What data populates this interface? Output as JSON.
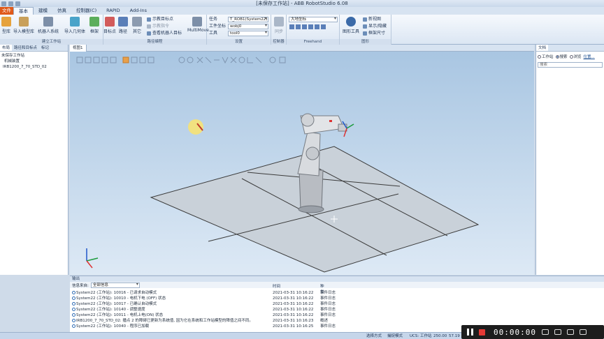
{
  "app": {
    "title": "[未保存工作站] - ABB RobotStudio 6.08"
  },
  "tabs": [
    {
      "label": "文件"
    },
    {
      "label": "基本"
    },
    {
      "label": "建模"
    },
    {
      "label": "仿真"
    },
    {
      "label": "控制器(C)"
    },
    {
      "label": "RAPID"
    },
    {
      "label": "Add-Ins"
    }
  ],
  "ribbon": {
    "build": {
      "label": "建立工作站",
      "abb_library": "型库",
      "import_library": "导入模型库",
      "robot_system": "机器人系统",
      "import_geometry": "导入几何体",
      "frame": "框架"
    },
    "path": {
      "label": "路径编程",
      "target": "目标点",
      "path": "路径",
      "other": "其它",
      "teach_target": "示教目标点",
      "teach_instruction": "示教指令",
      "view_robot_target": "查看机器人目标",
      "multimove": "MultiMove"
    },
    "settings": {
      "label": "设置",
      "task_label": "任务",
      "task_value": "T_ROB1(System22)",
      "wobj_label": "工件坐标",
      "wobj_value": "wobj0",
      "tool_label": "工具",
      "tool_value": "tool0"
    },
    "controller": {
      "label": "控制器",
      "sync": "同步"
    },
    "freehand": {
      "label": "Freehand",
      "frame_value": "大地坐标"
    },
    "graphics": {
      "label": "图形",
      "graphics_tools": "图形工具",
      "new_view": "新视图",
      "show_hide": "显示/隐藏",
      "frame_size": "框架尺寸"
    }
  },
  "left_panel": {
    "tabs": [
      "布局",
      "路径和目标点",
      "标记"
    ],
    "tree": [
      "未保存工作站",
      "机械装置",
      "IRB1200_7_70_STD_02"
    ]
  },
  "viewport": {
    "tab": "视图1"
  },
  "right_panel": {
    "title": "文档",
    "radio_workstation": "工作站",
    "radio_search": "搜索",
    "radio_browse": "浏览",
    "link_location": "位置...",
    "search_placeholder": "搜索"
  },
  "output": {
    "title": "输出",
    "filter_label": "信息来自:",
    "filter_value": "全部信息",
    "col_time": "时间",
    "col_category": "种类",
    "rows": [
      {
        "msg": "System22 (工作站): 10016 - 已请求自动模式",
        "time": "2021-03-31 10:16:22",
        "cat": "事件日志"
      },
      {
        "msg": "System22 (工作站): 10010 - 电机下电 (OFF) 状态",
        "time": "2021-03-31 10:16:22",
        "cat": "事件日志"
      },
      {
        "msg": "System22 (工作站): 10017 - 已确认自动模式",
        "time": "2021-03-31 10:16:22",
        "cat": "事件日志"
      },
      {
        "msg": "System22 (工作站): 10140 - 调整速度",
        "time": "2021-03-31 10:16:22",
        "cat": "事件日志"
      },
      {
        "msg": "System22 (工作站): 10011 - 电机上电(ON) 状态",
        "time": "2021-03-31 10:16:22",
        "cat": "事件日志"
      },
      {
        "msg": "IRB1200_7_70_STD_02: 播点 2 的障碍已更新为系统值, 因为它在系统和工作站模型的障值之间不同。",
        "time": "2021-03-31 10:16:23",
        "cat": "概述"
      },
      {
        "msg": "System22 (工作站): 10040 - 程序已加载",
        "time": "2021-03-31 10:16:25",
        "cat": "事件日志"
      }
    ]
  },
  "status_bar": {
    "select_mode": "选择方式",
    "snap_mode": "捕捉模式",
    "ucs": "UCS: 工作站",
    "x": "250.00",
    "y": "57.19"
  },
  "recorder": {
    "time": "00:00:00"
  },
  "colors": {
    "file_tab": "#e05a1a",
    "accent": "#1b4d8f",
    "record": "#e53935"
  }
}
